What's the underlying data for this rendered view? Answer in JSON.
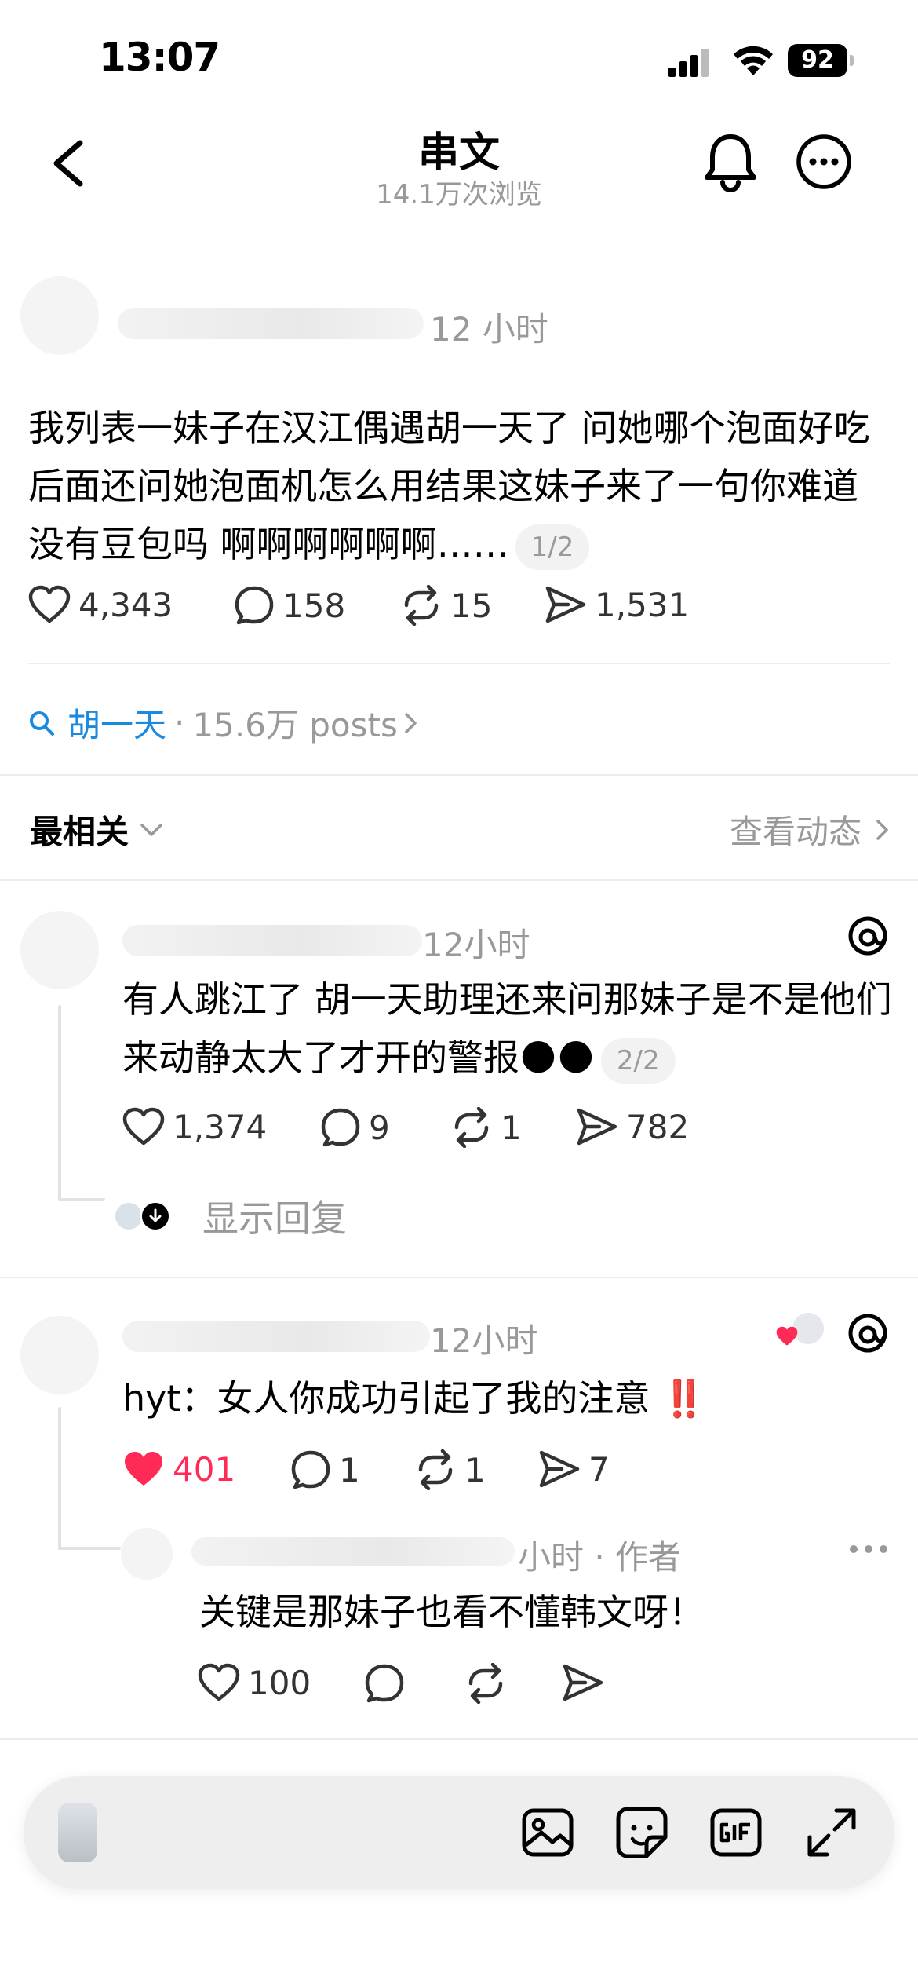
{
  "status": {
    "time": "13:07",
    "battery": "92"
  },
  "header": {
    "title": "串文",
    "views": "14.1万次浏览"
  },
  "main_post": {
    "time": "12 小时",
    "text": "我列表一妹子在汉江偶遇胡一天了 问她哪个泡面好吃 后面还问她泡面机怎么用结果这妹子来了一句你难道没有豆包吗 啊啊啊啊啊啊……",
    "page": "1/2",
    "likes": "4,343",
    "comments": "158",
    "reposts": "15",
    "shares": "1,531"
  },
  "topic": {
    "name": "胡一天",
    "count": "15.6万 posts",
    "sep": "·"
  },
  "sort": {
    "label": "最相关",
    "activity": "查看动态"
  },
  "replies": [
    {
      "time": "12小时",
      "text": "有人跳江了 胡一天助理还来问那妹子是不是他们来动静太大了才开的警报🌑🌑",
      "page": "2/2",
      "likes": "1,374",
      "comments": "9",
      "reposts": "1",
      "shares": "782",
      "show_replies": "显示回复"
    },
    {
      "time": "12小时",
      "text": "hyt：女人你成功引起了我的注意 ‼️",
      "likes": "401",
      "comments": "1",
      "reposts": "1",
      "shares": "7",
      "sub_reply": {
        "time": "小时 · 作者",
        "text": "关键是那妹子也看不懂韩文呀！",
        "likes": "100"
      }
    }
  ],
  "colors": {
    "like_red": "#ff2a55",
    "link_blue": "#1a8ae0",
    "muted": "#999999"
  },
  "icons": [
    "back-icon",
    "bell-icon",
    "more-icon",
    "heart-icon",
    "comment-icon",
    "repost-icon",
    "share-icon",
    "search-icon",
    "threads-icon",
    "image-icon",
    "sticker-icon",
    "gif-icon",
    "expand-icon"
  ]
}
